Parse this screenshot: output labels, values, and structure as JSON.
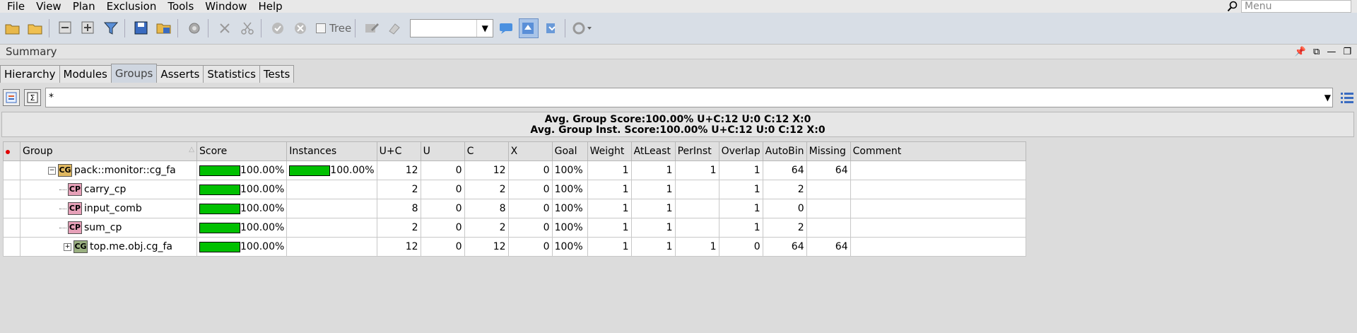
{
  "menu": {
    "items": [
      "File",
      "View",
      "Plan",
      "Exclusion",
      "Tools",
      "Window",
      "Help"
    ],
    "search_placeholder": "Menu"
  },
  "toolbar": {
    "tree_label": "Tree",
    "combo_value": ""
  },
  "summary": {
    "title": "Summary"
  },
  "tabs": [
    "Hierarchy",
    "Modules",
    "Groups",
    "Asserts",
    "Statistics",
    "Tests"
  ],
  "active_tab": "Groups",
  "filter": {
    "value": "*"
  },
  "stats": {
    "line1": "Avg. Group Score:100.00%  U+C:12  U:0  C:12  X:0",
    "line2": "Avg. Group Inst. Score:100.00%  U+C:12  U:0  C:12  X:0"
  },
  "table": {
    "columns": [
      "Group",
      "Score",
      "Instances",
      "U+C",
      "U",
      "C",
      "X",
      "Goal",
      "Weight",
      "AtLeast",
      "PerInst",
      "Overlap",
      "AutoBin",
      "Missing",
      "Comment"
    ],
    "rows": [
      {
        "name": "pack::monitor::cg_fa",
        "icon": "CG",
        "score": "100.00%",
        "instances": "100.00%",
        "uc": "12",
        "u": "0",
        "c": "12",
        "x": "0",
        "goal": "100%",
        "weight": "1",
        "atleast": "1",
        "perinst": "1",
        "overlap": "1",
        "autobin": "64",
        "missing": "64",
        "comment": ""
      },
      {
        "name": "carry_cp",
        "icon": "CP",
        "score": "100.00%",
        "instances": "",
        "uc": "2",
        "u": "0",
        "c": "2",
        "x": "0",
        "goal": "100%",
        "weight": "1",
        "atleast": "1",
        "perinst": "",
        "overlap": "1",
        "autobin": "2",
        "missing": "",
        "comment": ""
      },
      {
        "name": "input_comb",
        "icon": "CP",
        "score": "100.00%",
        "instances": "",
        "uc": "8",
        "u": "0",
        "c": "8",
        "x": "0",
        "goal": "100%",
        "weight": "1",
        "atleast": "1",
        "perinst": "",
        "overlap": "1",
        "autobin": "0",
        "missing": "",
        "comment": ""
      },
      {
        "name": "sum_cp",
        "icon": "CP",
        "score": "100.00%",
        "instances": "",
        "uc": "2",
        "u": "0",
        "c": "2",
        "x": "0",
        "goal": "100%",
        "weight": "1",
        "atleast": "1",
        "perinst": "",
        "overlap": "1",
        "autobin": "2",
        "missing": "",
        "comment": ""
      },
      {
        "name": "top.me.obj.cg_fa",
        "icon": "CG",
        "score": "100.00%",
        "instances": "",
        "uc": "12",
        "u": "0",
        "c": "12",
        "x": "0",
        "goal": "100%",
        "weight": "1",
        "atleast": "1",
        "perinst": "1",
        "overlap": "0",
        "autobin": "64",
        "missing": "64",
        "comment": ""
      }
    ]
  },
  "colors": {
    "score_bar": "#00c000",
    "toolbar_bg": "#d8dee6",
    "window_bg": "#dcdcdc"
  }
}
